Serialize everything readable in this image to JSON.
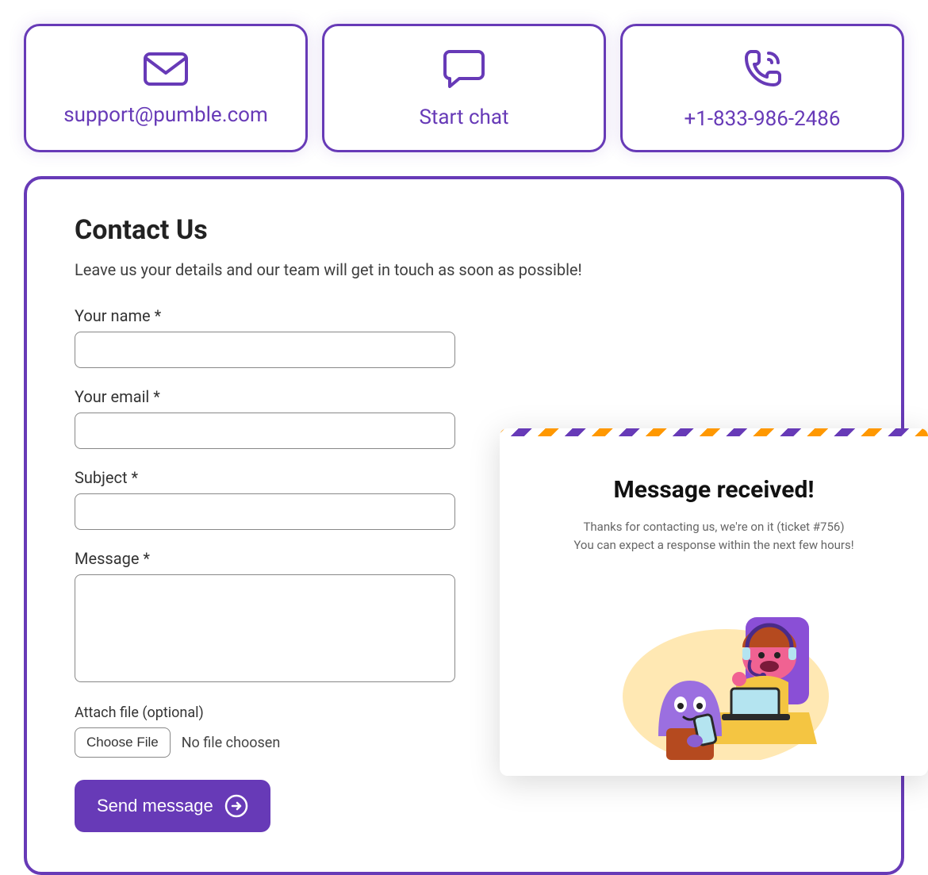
{
  "cards": {
    "email": "support@pumble.com",
    "chat": "Start chat",
    "phone": "+1-833-986-2486"
  },
  "form": {
    "title": "Contact Us",
    "subtitle": "Leave us your details and our team will get in touch as soon as possible!",
    "name_label": "Your name *",
    "email_label": "Your email *",
    "subject_label": "Subject *",
    "message_label": "Message *",
    "attach_label": "Attach file (optional)",
    "choose_file": "Choose File",
    "no_file": "No file choosen",
    "send": "Send message"
  },
  "popup": {
    "title": "Message received!",
    "line1": "Thanks for contacting us, we're on it (ticket #756)",
    "line2": "You can expect a response within the next few hours!"
  }
}
